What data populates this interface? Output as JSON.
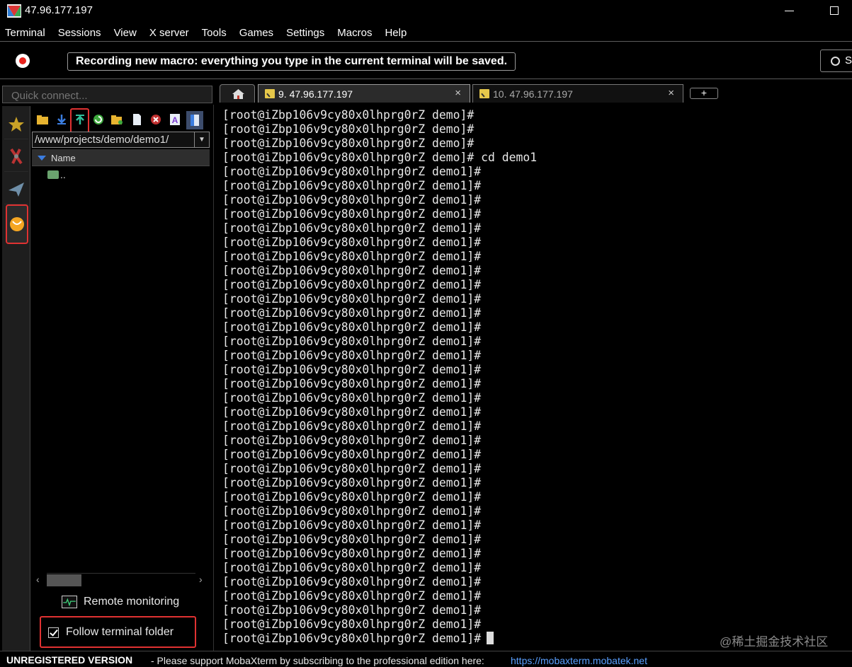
{
  "window": {
    "title": "47.96.177.197"
  },
  "menu": [
    "Terminal",
    "Sessions",
    "View",
    "X server",
    "Tools",
    "Games",
    "Settings",
    "Macros",
    "Help"
  ],
  "macro": {
    "message": "Recording new macro: everything you type in the current terminal will be saved.",
    "stop_label": "S"
  },
  "quick_connect": {
    "placeholder": "Quick connect..."
  },
  "tabs": [
    {
      "label": "9. 47.96.177.197",
      "close": "×"
    },
    {
      "label": "10. 47.96.177.197",
      "close": "×"
    }
  ],
  "tab_add": "+",
  "file_browser": {
    "path": "/www/projects/demo/demo1/",
    "column_name": "Name",
    "parent_entry": "..",
    "remote_monitoring": "Remote monitoring",
    "follow_folder": "Follow terminal folder"
  },
  "terminal": {
    "lines": [
      "[root@iZbp106v9cy80x0lhprg0rZ demo]#",
      "[root@iZbp106v9cy80x0lhprg0rZ demo]#",
      "[root@iZbp106v9cy80x0lhprg0rZ demo]#",
      "[root@iZbp106v9cy80x0lhprg0rZ demo]# cd demo1",
      "[root@iZbp106v9cy80x0lhprg0rZ demo1]#",
      "[root@iZbp106v9cy80x0lhprg0rZ demo1]#",
      "[root@iZbp106v9cy80x0lhprg0rZ demo1]#",
      "[root@iZbp106v9cy80x0lhprg0rZ demo1]#",
      "[root@iZbp106v9cy80x0lhprg0rZ demo1]#",
      "[root@iZbp106v9cy80x0lhprg0rZ demo1]#",
      "[root@iZbp106v9cy80x0lhprg0rZ demo1]#",
      "[root@iZbp106v9cy80x0lhprg0rZ demo1]#",
      "[root@iZbp106v9cy80x0lhprg0rZ demo1]#",
      "[root@iZbp106v9cy80x0lhprg0rZ demo1]#",
      "[root@iZbp106v9cy80x0lhprg0rZ demo1]#",
      "[root@iZbp106v9cy80x0lhprg0rZ demo1]#",
      "[root@iZbp106v9cy80x0lhprg0rZ demo1]#",
      "[root@iZbp106v9cy80x0lhprg0rZ demo1]#",
      "[root@iZbp106v9cy80x0lhprg0rZ demo1]#",
      "[root@iZbp106v9cy80x0lhprg0rZ demo1]#",
      "[root@iZbp106v9cy80x0lhprg0rZ demo1]#",
      "[root@iZbp106v9cy80x0lhprg0rZ demo1]#",
      "[root@iZbp106v9cy80x0lhprg0rZ demo1]#",
      "[root@iZbp106v9cy80x0lhprg0rZ demo1]#",
      "[root@iZbp106v9cy80x0lhprg0rZ demo1]#",
      "[root@iZbp106v9cy80x0lhprg0rZ demo1]#",
      "[root@iZbp106v9cy80x0lhprg0rZ demo1]#",
      "[root@iZbp106v9cy80x0lhprg0rZ demo1]#",
      "[root@iZbp106v9cy80x0lhprg0rZ demo1]#",
      "[root@iZbp106v9cy80x0lhprg0rZ demo1]#",
      "[root@iZbp106v9cy80x0lhprg0rZ demo1]#",
      "[root@iZbp106v9cy80x0lhprg0rZ demo1]#",
      "[root@iZbp106v9cy80x0lhprg0rZ demo1]#",
      "[root@iZbp106v9cy80x0lhprg0rZ demo1]#",
      "[root@iZbp106v9cy80x0lhprg0rZ demo1]#",
      "[root@iZbp106v9cy80x0lhprg0rZ demo1]#",
      "[root@iZbp106v9cy80x0lhprg0rZ demo1]#",
      "[root@iZbp106v9cy80x0lhprg0rZ demo1]#"
    ],
    "watermark": "@稀土掘金技术社区"
  },
  "status": {
    "unregistered": "UNREGISTERED VERSION",
    "message": "-  Please support MobaXterm by subscribing to the professional edition here:",
    "link": "https://mobaxterm.mobatek.net"
  },
  "colors": {
    "highlight": "#e03232",
    "link": "#5aa0ff",
    "background": "#000000"
  }
}
